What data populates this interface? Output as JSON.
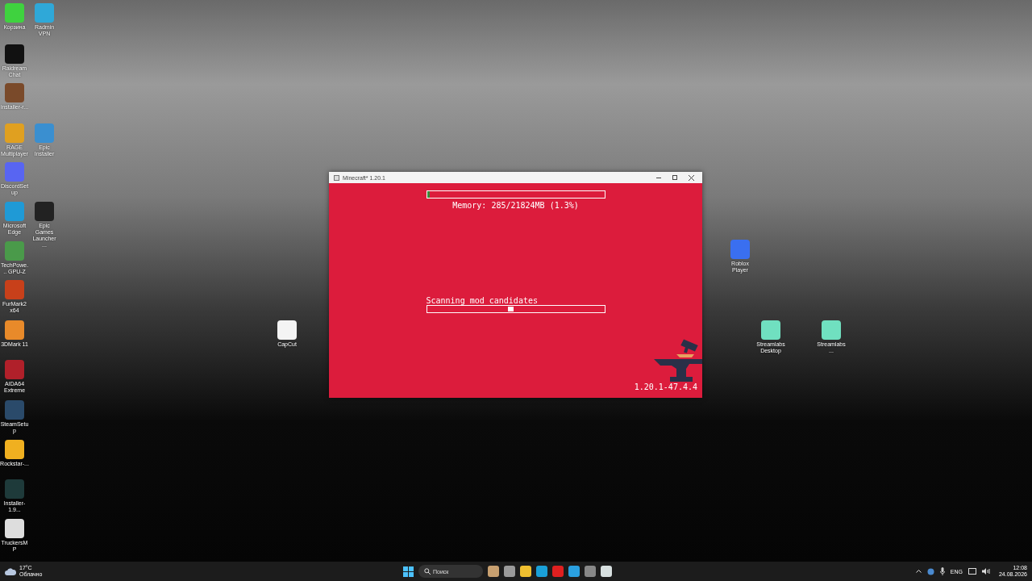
{
  "desktop_icons": [
    {
      "label": "Корзина",
      "color": "#3fd23f"
    },
    {
      "label": "Radmin VPN",
      "color": "#2fa8d8"
    },
    {
      "label": "Raidream Chat",
      "color": "#111111"
    },
    {
      "label": "installer-r...",
      "color": "#7a4a2a"
    },
    {
      "label": "RAGE Multiplayer",
      "color": "#e0a020"
    },
    {
      "label": "Epic Installer",
      "color": "#3a8fd0"
    },
    {
      "label": "DiscordSetup",
      "color": "#5865f2"
    },
    {
      "label": "Microsoft Edge",
      "color": "#1f9ad6"
    },
    {
      "label": "Epic Games Launcher ...",
      "color": "#222222"
    },
    {
      "label": "TechPowe... GPU-Z",
      "color": "#4a9a4a"
    },
    {
      "label": "FurMark2 x64",
      "color": "#c8401a"
    },
    {
      "label": "3DMark 11",
      "color": "#e88a2a"
    },
    {
      "label": "AIDA64 Extreme",
      "color": "#b0202a"
    },
    {
      "label": "SteamSetup",
      "color": "#2a4a6a"
    },
    {
      "label": "Rockstar-...",
      "color": "#f0b020"
    },
    {
      "label": "Installer-1.9...",
      "color": "#1e3a3a"
    },
    {
      "label": "TruckersMP",
      "color": "#dddddd"
    },
    {
      "label": "CapCut",
      "color": "#f4f4f4"
    },
    {
      "label": "Roblox Player",
      "color": "#3a6ff0"
    },
    {
      "label": "Streamlabs Desktop",
      "color": "#70e0c0"
    },
    {
      "label": "Streamlabs...",
      "color": "#70e0c0"
    }
  ],
  "window": {
    "title": "Minecraft* 1.20.1",
    "memory_bar": {
      "level": 0.013
    },
    "memory_text": "Memory: 285/21824MB (1.3%)",
    "progress_label": "Scanning mod candidates",
    "progress_bar": {
      "level": 0.47
    },
    "version": "1.20.1-47.4.4"
  },
  "taskbar": {
    "weather": {
      "temperature": "17°C",
      "condition": "Облачно"
    },
    "search": {
      "placeholder": "Поиск"
    },
    "apps": [
      {
        "color": "#c8a070"
      },
      {
        "color": "#9a9a9a"
      },
      {
        "color": "#f0c030"
      },
      {
        "color": "#1aa0d8"
      },
      {
        "color": "#e02020"
      },
      {
        "color": "#2aa0e0"
      },
      {
        "color": "#888888"
      },
      {
        "color": "#d8e0e0"
      }
    ],
    "language": "ENG",
    "time": "12:08",
    "date": "24.08.2026"
  }
}
